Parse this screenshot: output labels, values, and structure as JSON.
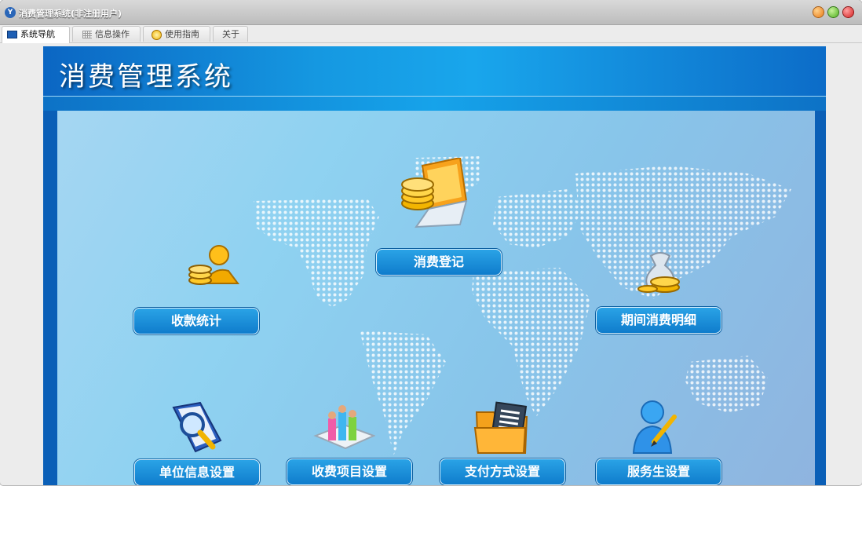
{
  "window": {
    "title": "消费管理系统(非注册用户)"
  },
  "tabs": [
    {
      "label": "系统导航",
      "icon": "monitor-icon",
      "active": true
    },
    {
      "label": "信息操作",
      "icon": "grid-icon",
      "active": false
    },
    {
      "label": "使用指南",
      "icon": "help-icon",
      "active": false
    },
    {
      "label": "关于",
      "icon": "",
      "active": false
    }
  ],
  "banner": {
    "title": "消费管理系统"
  },
  "nav": {
    "consume_register": "消费登记",
    "receipt_stats": "收款统计",
    "period_detail": "期间消费明细",
    "unit_info": "单位信息设置",
    "fee_items": "收费项目设置",
    "payment_methods": "支付方式设置",
    "waiter_settings": "服务生设置"
  },
  "colors": {
    "accent": "#1598e1",
    "button": "#1782d2",
    "panel": "#8fd2f1"
  }
}
